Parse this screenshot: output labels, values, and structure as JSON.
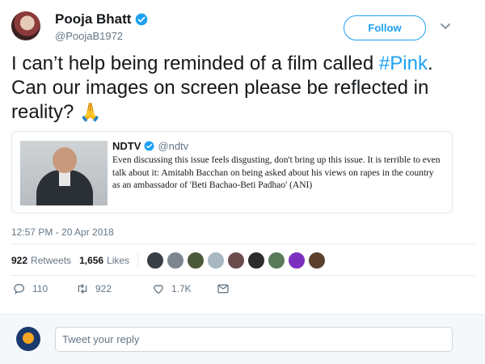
{
  "author": {
    "display_name": "Pooja Bhatt",
    "handle": "@PoojaB1972",
    "verified": true
  },
  "follow_button": {
    "label": "Follow"
  },
  "tweet": {
    "text_before": "I can’t help being reminded of a film called ",
    "hashtag": "#Pink",
    "text_after": ". Can our images on screen please be reflected in reality? ",
    "emoji": "🙏"
  },
  "quoted_tweet": {
    "name": "NDTV",
    "handle": "@ndtv",
    "verified": true,
    "text": "Even discussing this issue feels disgusting, don't bring up this issue. It is terrible to even talk about it: Amitabh Bacchan on being asked about his views on rapes in the country as an ambassador of 'Beti Bachao-Beti Padhao' (ANI)"
  },
  "timestamp": "12:57 PM - 20 Apr 2018",
  "stats": {
    "retweets_count": "922",
    "retweets_label": "Retweets",
    "likes_count": "1,656",
    "likes_label": "Likes"
  },
  "liker_avatar_colors": [
    "#3a3f45",
    "#7d8690",
    "#4a5a3a",
    "#a7b8c2",
    "#6b4b4b",
    "#2c2c2c",
    "#5a7a5a",
    "#7b2fbe",
    "#5b4030"
  ],
  "actions": {
    "reply_count": "110",
    "retweet_count": "922",
    "like_count": "1.7K"
  },
  "reply_box": {
    "placeholder": "Tweet your reply"
  },
  "colors": {
    "accent": "#1da1f2",
    "muted": "#657786"
  }
}
